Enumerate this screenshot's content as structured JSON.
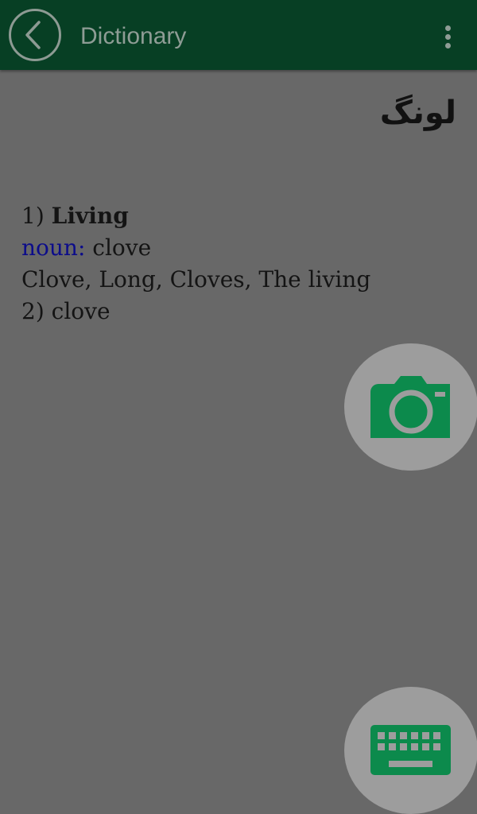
{
  "toolbar": {
    "title": "Dictionary",
    "back_icon": "chevron-left-circle-icon",
    "menu_icon": "more-vert-icon"
  },
  "headword": "لونگ",
  "entries": [
    {
      "number": "1)",
      "word": "Living"
    },
    {
      "pos_label": "noun:",
      "meaning": "clove"
    },
    {
      "synonyms": "Clove, Long, Cloves, The living"
    },
    {
      "number": "2)",
      "word": "clove"
    }
  ],
  "fabs": {
    "camera_icon": "camera-icon",
    "keyboard_icon": "keyboard-icon"
  },
  "colors": {
    "toolbar": "#073f24",
    "overlay_background": "#686868",
    "icon_green": "#0c8a4c",
    "pos_blue": "#0c0c8a"
  }
}
